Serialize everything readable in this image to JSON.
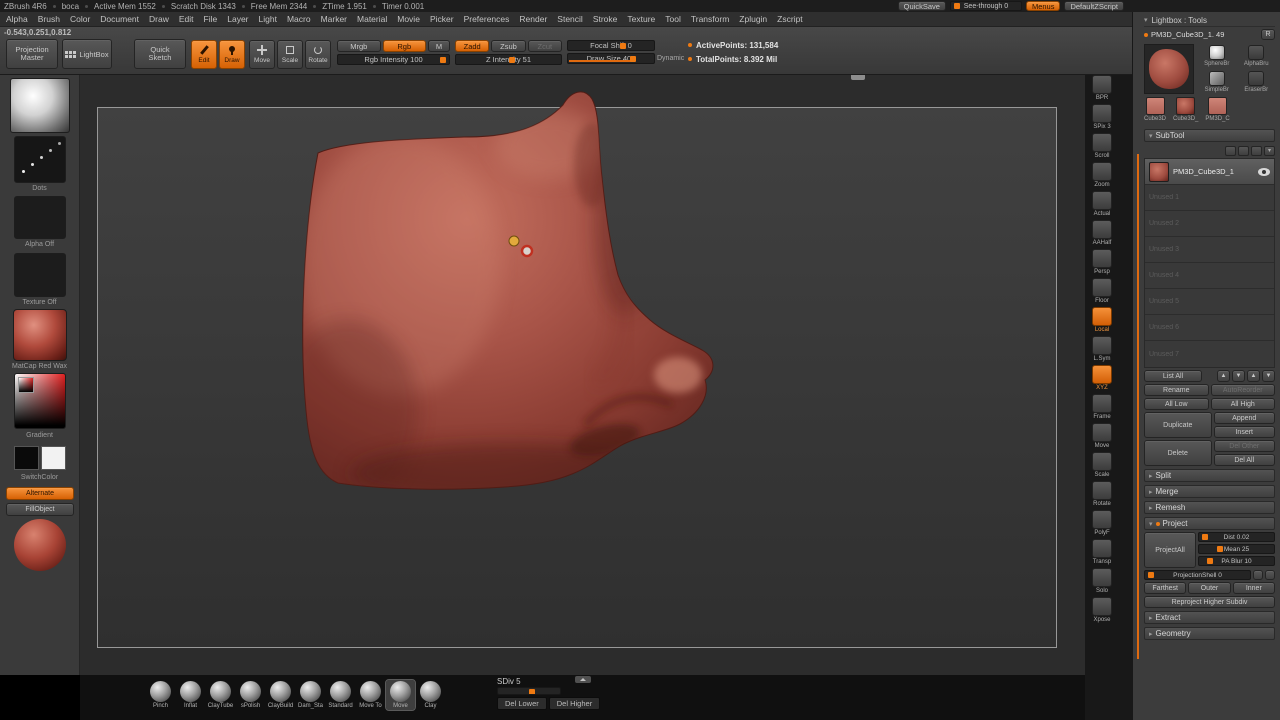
{
  "accent": "#e06a10",
  "titlebar": {
    "segments": [
      "ZBrush 4R6",
      "boca",
      "Active Mem 1552",
      "Scratch Disk 1343",
      "Free Mem 2344",
      "ZTime 1.951",
      "Timer 0.001"
    ],
    "quicksave": "QuickSave",
    "see_through": "See-through 0",
    "menus_btn": "Menus",
    "default_zscript": "DefaultZScript"
  },
  "menus": [
    "Alpha",
    "Brush",
    "Color",
    "Document",
    "Draw",
    "Edit",
    "File",
    "Layer",
    "Light",
    "Macro",
    "Marker",
    "Material",
    "Movie",
    "Picker",
    "Preferences",
    "Render",
    "Stencil",
    "Stroke",
    "Texture",
    "Tool",
    "Transform",
    "Zplugin",
    "Zscript"
  ],
  "coords": "-0.543,0.251,0.812",
  "shelf": {
    "projection_master_l1": "Projection",
    "projection_master_l2": "Master",
    "lightbox": "LightBox",
    "quick_sketch_l1": "Quick",
    "quick_sketch_l2": "Sketch",
    "edit": "Edit",
    "draw": "Draw",
    "move": "Move",
    "scale": "Scale",
    "rotate": "Rotate",
    "mrgb": "Mrgb",
    "rgb": "Rgb",
    "m": "M",
    "rgb_intensity": "Rgb Intensity 100",
    "zadd": "Zadd",
    "zsub": "Zsub",
    "zcut": "Zcut",
    "z_intensity": "Z Intensity 51",
    "focal_shift": "Focal Shift 0",
    "draw_size": "Draw Size 401",
    "dynamic": "Dynamic",
    "active_points": "ActivePoints: 131,584",
    "total_points": "TotalPoints: 8.392 Mil"
  },
  "left_tray": {
    "stroke_label": "Dots",
    "alpha_label": "Alpha Off",
    "texture_label": "Texture Off",
    "material_label": "MatCap Red Wax",
    "gradient_label": "Gradient",
    "switch_label": "SwitchColor",
    "alternate": "Alternate",
    "fill_object": "FillObject"
  },
  "right_strip": [
    {
      "label": "BPR"
    },
    {
      "label": "SPix 3"
    },
    {
      "label": "Scroll"
    },
    {
      "label": "Zoom"
    },
    {
      "label": "Actual"
    },
    {
      "label": "AAHalf"
    },
    {
      "label": "Persp"
    },
    {
      "label": "Floor"
    },
    {
      "label": "Local",
      "state": "active"
    },
    {
      "label": "L.Sym"
    },
    {
      "label": "XYZ",
      "state": "active"
    },
    {
      "label": "Frame"
    },
    {
      "label": "Move"
    },
    {
      "label": "Scale"
    },
    {
      "label": "Rotate"
    },
    {
      "label": "PolyF"
    },
    {
      "label": "Transp"
    },
    {
      "label": "Solo"
    },
    {
      "label": "Xpose"
    }
  ],
  "tool": {
    "header": "Lightbox : Tools",
    "name": "PM3D_Cube3D_1. 49",
    "r": "R",
    "side_icons": [
      {
        "label": "SphereBr"
      },
      {
        "label": "AlphaBru"
      },
      {
        "label": "SimpleBr"
      },
      {
        "label": "EraserBr"
      }
    ],
    "recent": [
      {
        "label": "Cube3D"
      },
      {
        "label": "Cube3D_"
      },
      {
        "label": "PM3D_C"
      }
    ]
  },
  "subtool": {
    "header": "SubTool",
    "rows": [
      {
        "name": "PM3D_Cube3D_1",
        "state": "selected"
      },
      {
        "name": "Unused 1"
      },
      {
        "name": "Unused 2"
      },
      {
        "name": "Unused 3"
      },
      {
        "name": "Unused 4"
      },
      {
        "name": "Unused 5"
      },
      {
        "name": "Unused 6"
      },
      {
        "name": "Unused 7"
      }
    ],
    "list_all": "List All",
    "up": "▲",
    "down": "▼",
    "rename": "Rename",
    "autoreorder": "AutoReorder",
    "all_low": "All Low",
    "all_high": "All High",
    "duplicate": "Duplicate",
    "append": "Append",
    "insert": "Insert",
    "delete": "Delete",
    "del_other": "Del Other",
    "del_all": "Del All",
    "split": "Split",
    "merge": "Merge",
    "remesh": "Remesh",
    "project": "Project",
    "project_all": "ProjectAll",
    "dist": "Dist 0.02",
    "mean": "Mean 25",
    "pa_blur": "PA Blur 10",
    "projection_shell": "ProjectionShell 0",
    "farthest": "Farthest",
    "outer": "Outer",
    "inner": "Inner",
    "reproject": "Reproject Higher Subdiv",
    "extract": "Extract",
    "geometry": "Geometry"
  },
  "bottom": {
    "brushes": [
      {
        "label": "Pinch"
      },
      {
        "label": "Inflat"
      },
      {
        "label": "ClayTube"
      },
      {
        "label": "sPolish"
      },
      {
        "label": "ClayBuild"
      },
      {
        "label": "Dam_Sta"
      },
      {
        "label": "Standard"
      },
      {
        "label": "Move To"
      },
      {
        "label": "Move",
        "state": "selected"
      },
      {
        "label": "Clay"
      }
    ],
    "sdiv": "SDiv 5",
    "del_lower": "Del Lower",
    "del_higher": "Del Higher"
  }
}
